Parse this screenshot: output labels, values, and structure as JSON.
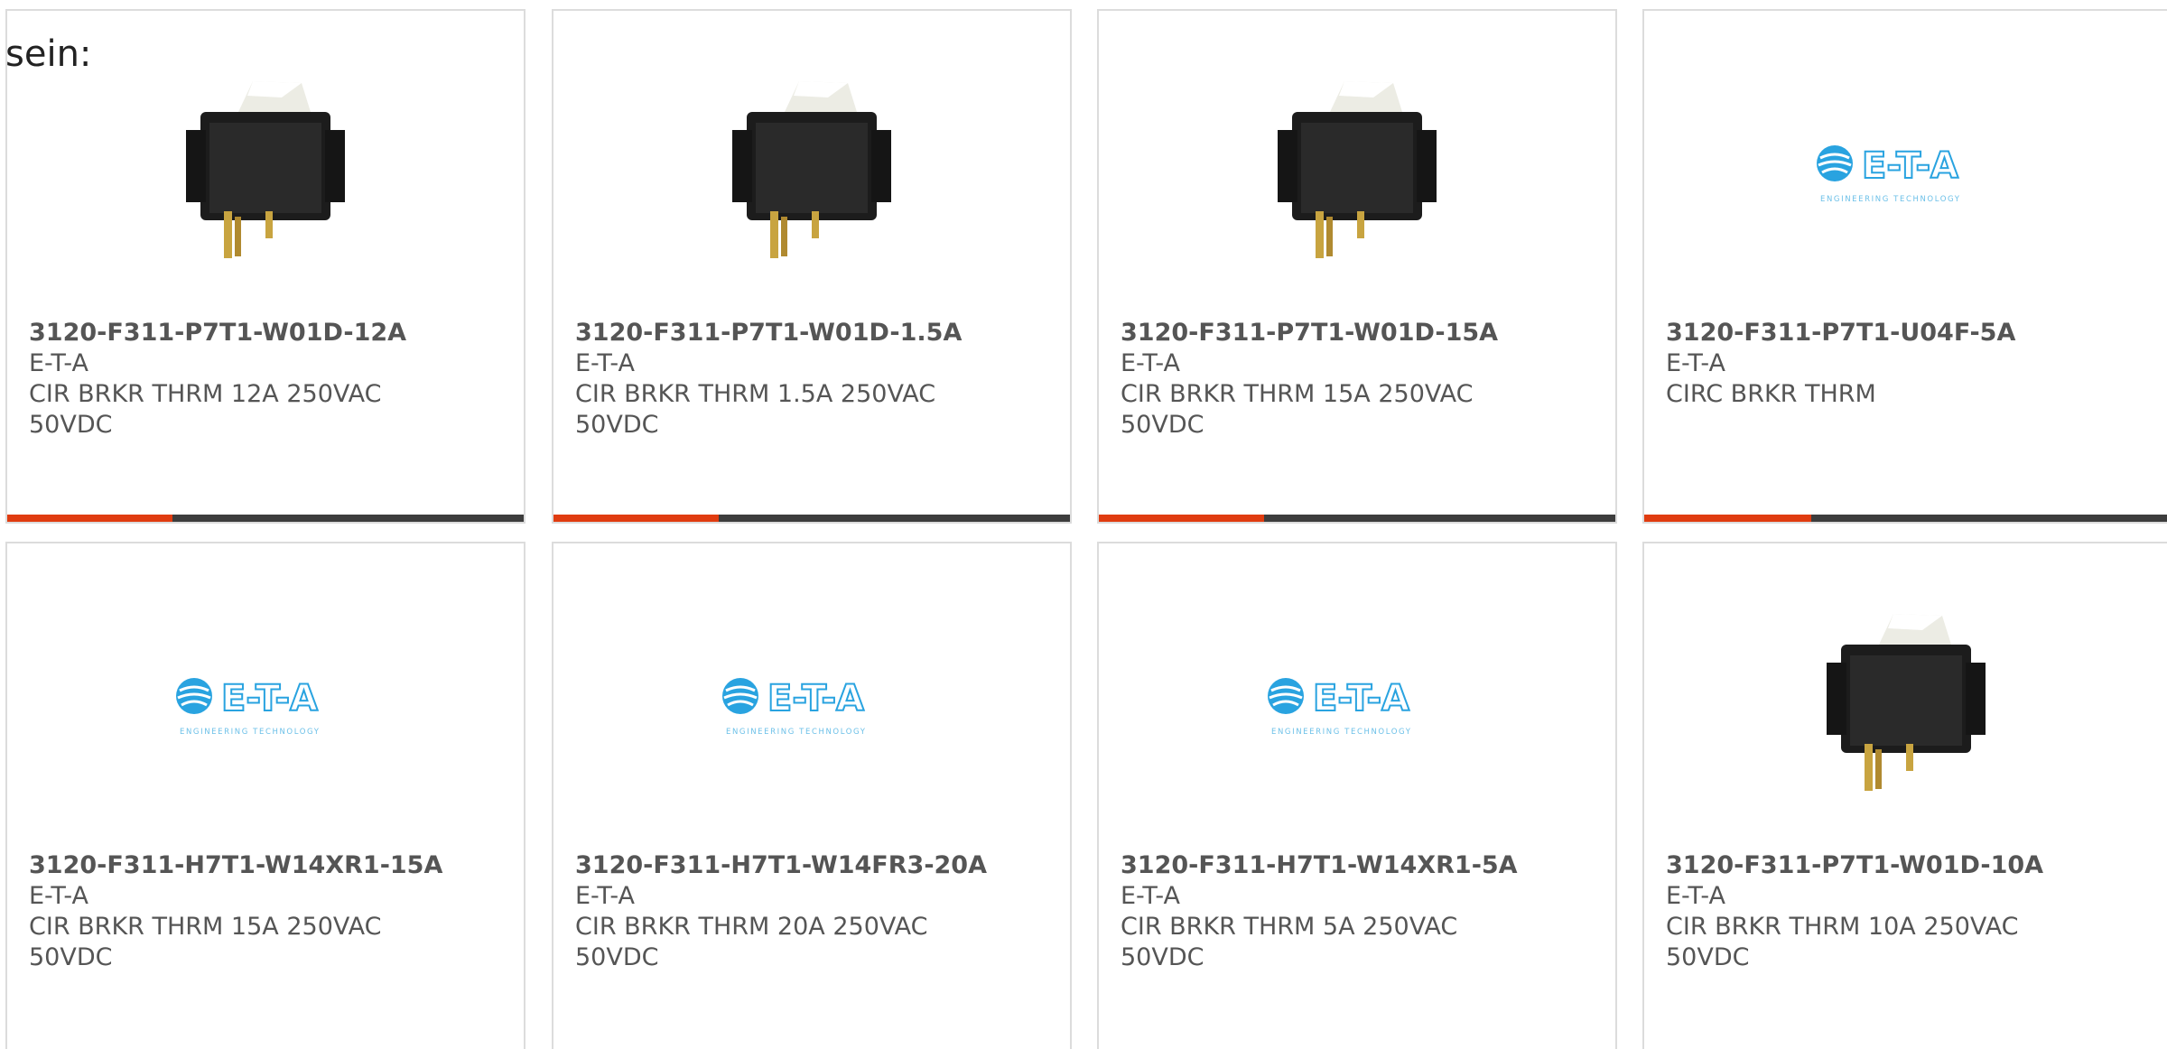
{
  "header": {
    "label": "sein:"
  },
  "colors": {
    "accent": "#e03c10",
    "bar": "#3d3d3d",
    "text": "#555555",
    "logo_blue": "#29a3e0"
  },
  "logo_text": {
    "brand": "E-T-A",
    "tagline": "ENGINEERING TECHNOLOGY"
  },
  "products": [
    {
      "image_icon": "rocker-switch-icon",
      "part": "3120-F311-P7T1-W01D-12A",
      "maker": "E-T-A",
      "desc1": "CIR BRKR THRM 12A 250VAC",
      "desc2": "50VDC",
      "progress": 0.32
    },
    {
      "image_icon": "rocker-switch-icon",
      "part": "3120-F311-P7T1-W01D-1.5A",
      "maker": "E-T-A",
      "desc1": "CIR BRKR THRM 1.5A 250VAC",
      "desc2": "50VDC",
      "progress": 0.32
    },
    {
      "image_icon": "rocker-switch-icon",
      "part": "3120-F311-P7T1-W01D-15A",
      "maker": "E-T-A",
      "desc1": "CIR BRKR THRM 15A 250VAC",
      "desc2": "50VDC",
      "progress": 0.32
    },
    {
      "image_icon": "eta-logo-icon",
      "part": "3120-F311-P7T1-U04F-5A",
      "maker": "E-T-A",
      "desc1": "CIRC BRKR THRM",
      "desc2": "",
      "progress": 0.32
    },
    {
      "image_icon": "eta-logo-icon",
      "part": "3120-F311-H7T1-W14XR1-15A",
      "maker": "E-T-A",
      "desc1": "CIR BRKR THRM 15A 250VAC",
      "desc2": "50VDC"
    },
    {
      "image_icon": "eta-logo-icon",
      "part": "3120-F311-H7T1-W14FR3-20A",
      "maker": "E-T-A",
      "desc1": "CIR BRKR THRM 20A 250VAC",
      "desc2": "50VDC"
    },
    {
      "image_icon": "eta-logo-icon",
      "part": "3120-F311-H7T1-W14XR1-5A",
      "maker": "E-T-A",
      "desc1": "CIR BRKR THRM 5A 250VAC",
      "desc2": "50VDC"
    },
    {
      "image_icon": "rocker-switch-icon",
      "part": "3120-F311-P7T1-W01D-10A",
      "maker": "E-T-A",
      "desc1": "CIR BRKR THRM 10A 250VAC",
      "desc2": "50VDC"
    }
  ]
}
